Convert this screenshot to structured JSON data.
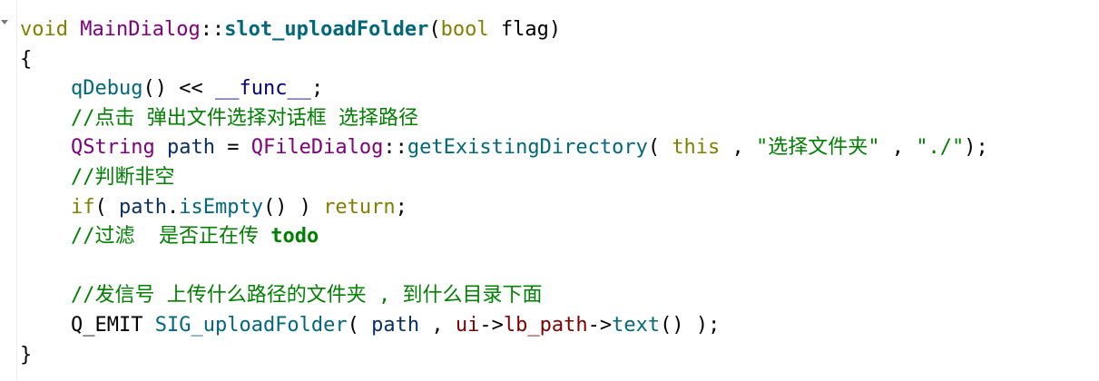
{
  "editor": {
    "lines": [
      {
        "t0": "void",
        "t1": " ",
        "t2": "MainDialog",
        "t3": "::",
        "t4": "slot_uploadFolder",
        "t5": "(",
        "t6": "bool",
        "t7": " ",
        "t8": "flag",
        "t9": ")"
      },
      {
        "t0": "{"
      },
      {
        "t0": "qDebug",
        "t1": "() << ",
        "t2": "__func__",
        "t3": ";"
      },
      {
        "t0": "//点击 弹出文件选择对话框 选择路径"
      },
      {
        "t0": "QString",
        "t1": " ",
        "t2": "path",
        "t3": " = ",
        "t4": "QFileDialog",
        "t5": "::",
        "t6": "getExistingDirectory",
        "t7": "( ",
        "t8": "this",
        "t9": " , ",
        "t10": "\"选择文件夹\"",
        "t11": " , ",
        "t12": "\"./\"",
        "t13": ");"
      },
      {
        "t0": "//判断非空"
      },
      {
        "t0": "if",
        "t1": "( ",
        "t2": "path",
        "t3": ".",
        "t4": "isEmpty",
        "t5": "() ) ",
        "t6": "return",
        "t7": ";"
      },
      {
        "t0": "//过滤  是否正在传 ",
        "t1": "todo"
      },
      {},
      {
        "t0": "//发信号 上传什么路径的文件夹 , 到什么目录下面"
      },
      {
        "t0": "Q_EMIT",
        "t1": " ",
        "t2": "SIG_uploadFolder",
        "t3": "( ",
        "t4": "path",
        "t5": " , ",
        "t6": "ui",
        "t7": "->",
        "t8": "lb_path",
        "t9": "->",
        "t10": "text",
        "t11": "() );"
      },
      {
        "t0": "}"
      }
    ]
  }
}
